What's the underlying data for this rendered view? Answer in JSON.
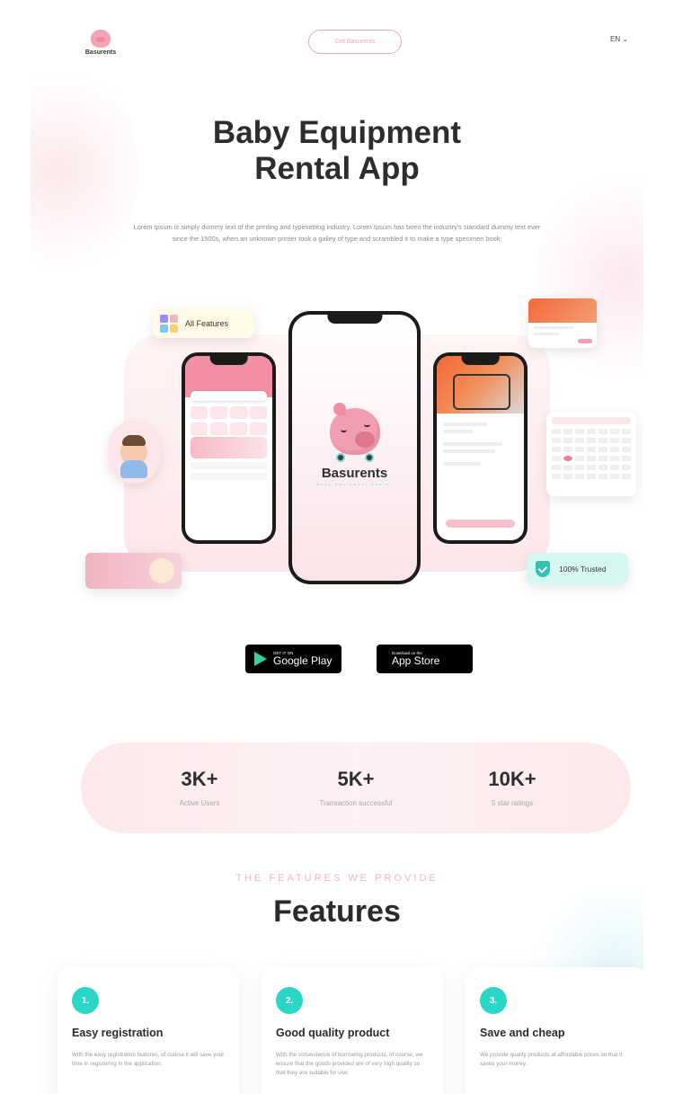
{
  "header": {
    "brand": "Basurents",
    "cta_label": "Get Basurents",
    "language": "EN"
  },
  "hero": {
    "title_line1": "Baby Equipment",
    "title_line2": "Rental App",
    "description": "Lorem Ipsum is simply dummy text of the printing and typesetting industry. Lorem Ipsum has been the industry's standard dummy text ever since the 1500s, when an unknown printer took a galley of type and scrambled it to make a type specimen book."
  },
  "mockup": {
    "center_brand": "Basurents",
    "center_tagline": "Baby Equipment Rental",
    "all_features_label": "All Features",
    "trusted_label": "100% Trusted"
  },
  "stores": {
    "google_small": "GET IT ON",
    "google_big": "Google Play",
    "apple_small": "Download on the",
    "apple_big": "App Store"
  },
  "stats": [
    {
      "value": "3K+",
      "label": "Active Users"
    },
    {
      "value": "5K+",
      "label": "Transaction successful"
    },
    {
      "value": "10K+",
      "label": "5 star ratings"
    }
  ],
  "features": {
    "eyebrow": "THE FEATURES WE PROVIDE",
    "title": "Features",
    "items": [
      {
        "number": "1.",
        "title": "Easy registration",
        "text": "With the easy registration features, of course it will save your time in registering in the application."
      },
      {
        "number": "2.",
        "title": "Good quality  product",
        "text": "With the convenience of borrowing products, of course, we ensure that the goods provided are of very high quality so that they are suitable for use."
      },
      {
        "number": "3.",
        "title": "Save and cheap",
        "text": "We provide quality products at affordable prices so that it saves your money."
      }
    ]
  },
  "colors": {
    "accent_pink": "#f19fb0",
    "accent_teal": "#2ad6c6",
    "text_dark": "#2b2b2b"
  }
}
